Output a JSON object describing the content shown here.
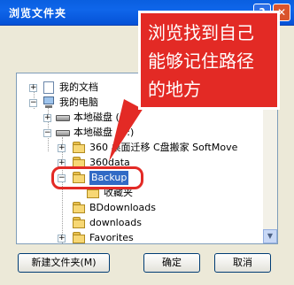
{
  "window": {
    "title": "浏览文件夹",
    "help_label": "?",
    "close_label": "✕"
  },
  "tree": {
    "nodes": [
      {
        "label": "我的文档",
        "expander": "+",
        "icon": "documents-icon"
      },
      {
        "label": "我的电脑",
        "expander": "−",
        "icon": "computer-icon"
      },
      {
        "label": "本地磁盘 (C:)",
        "expander": "+",
        "icon": "drive-icon"
      },
      {
        "label": "本地磁盘 (D:)",
        "expander": "−",
        "icon": "drive-icon"
      },
      {
        "label": "360 桌面迁移 C盘搬家 SoftMove",
        "expander": "+",
        "icon": "folder-icon"
      },
      {
        "label": "360data",
        "expander": "+",
        "icon": "folder-icon"
      },
      {
        "label": "Backup",
        "expander": "−",
        "icon": "folder-icon",
        "selected": true
      },
      {
        "label": "收藏夹",
        "expander": "",
        "icon": "folder-icon"
      },
      {
        "label": "BDdownloads",
        "expander": "",
        "icon": "folder-icon"
      },
      {
        "label": "downloads",
        "expander": "",
        "icon": "folder-icon"
      },
      {
        "label": "Favorites",
        "expander": "+",
        "icon": "folder-icon"
      }
    ]
  },
  "buttons": {
    "new_folder": "新建文件夹(M)",
    "ok": "确定",
    "cancel": "取消"
  },
  "annotation": {
    "text": "浏览找到自己能够记住路径的地方"
  }
}
